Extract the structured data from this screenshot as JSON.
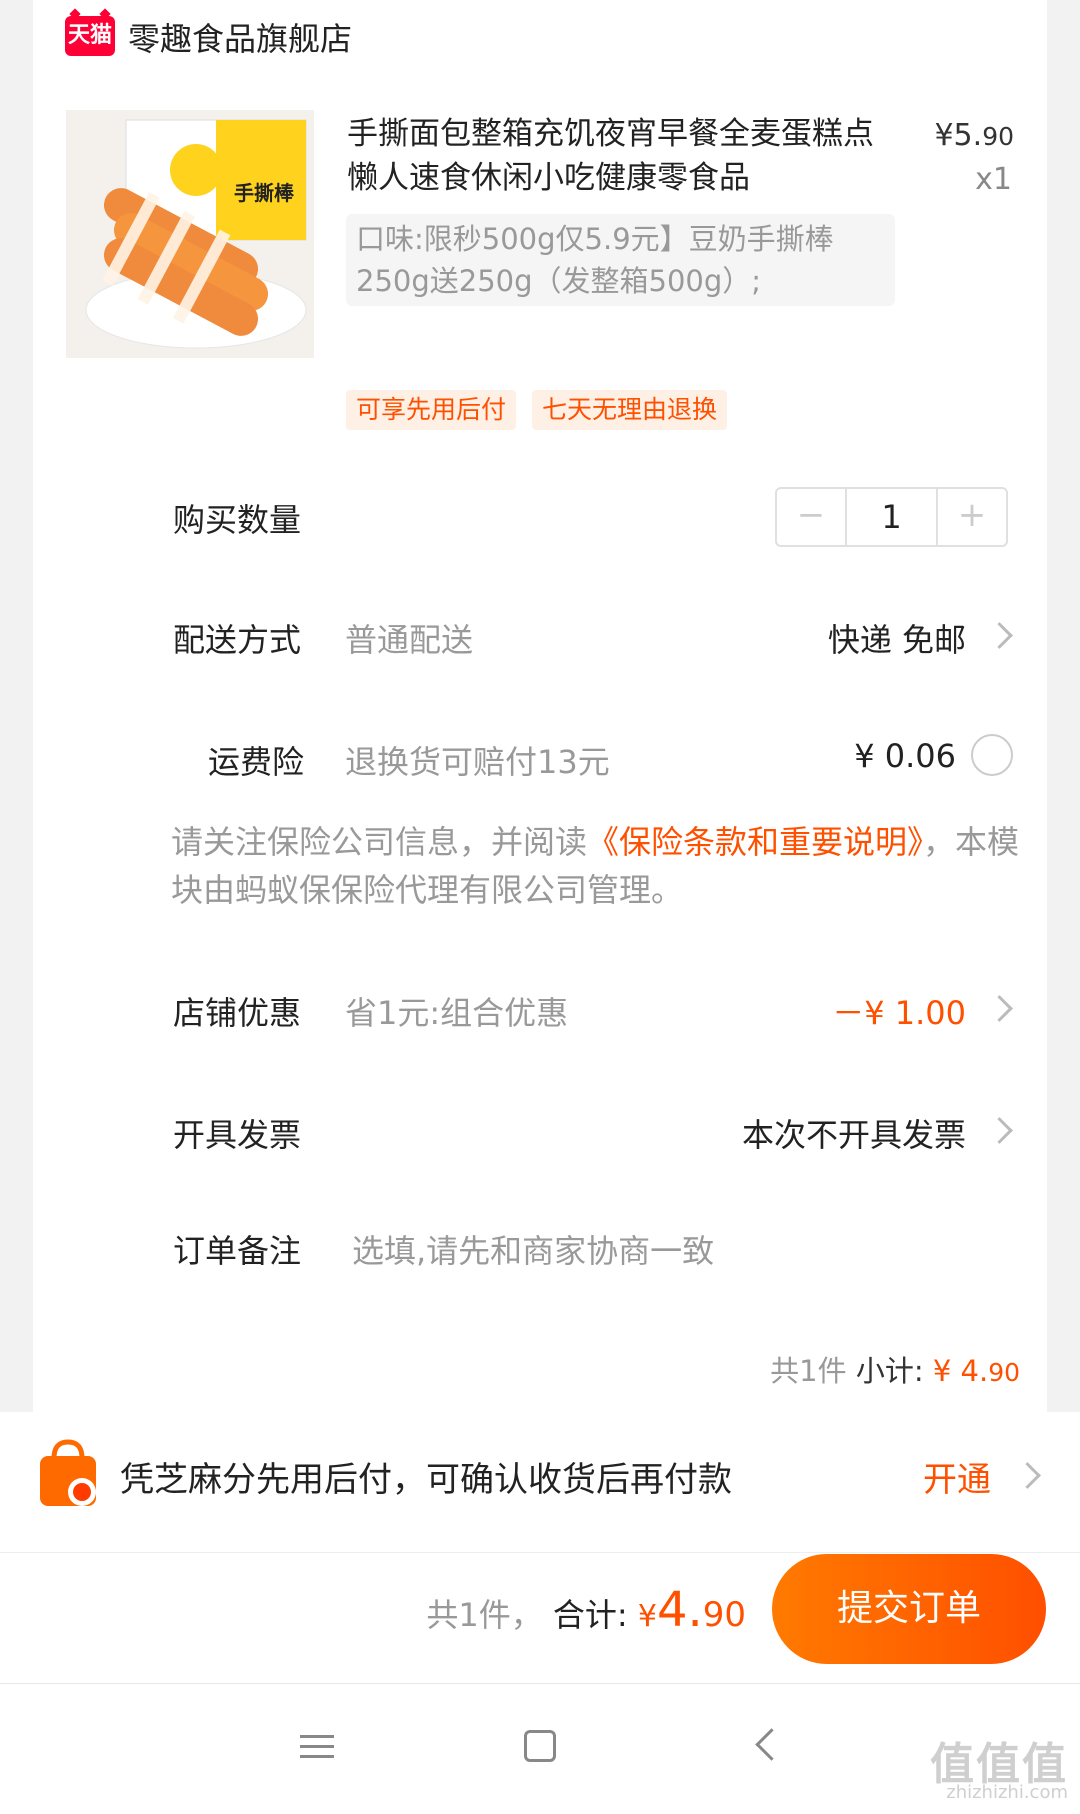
{
  "store": {
    "badge": "天猫",
    "name": "零趣食品旗舰店"
  },
  "product": {
    "title": "手撕面包整箱充饥夜宵早餐全麦蛋糕点懒人速食休闲小吃健康零食品",
    "price_main": "¥5.",
    "price_cents": "90",
    "quantity_label": "x1",
    "sku": "口味:限秒500g仅5.9元】豆奶手撕棒250g送250g（发整箱500g）;",
    "tags": [
      "可享先用后付",
      "七天无理由退换"
    ],
    "image_icon": "bread-rolls-image",
    "image_text": "手撕棒"
  },
  "rows": {
    "quantity": {
      "label": "购买数量",
      "minus": "−",
      "value": "1",
      "plus": "+"
    },
    "delivery": {
      "label": "配送方式",
      "sub": "普通配送",
      "value": "快递 免邮"
    },
    "insurance": {
      "label": "运费险",
      "sub": "退换货可赔付13元",
      "value": "¥ 0.06"
    },
    "insurance_notice": {
      "prefix": "请关注保险公司信息，并阅读",
      "link": "《保险条款和重要说明》",
      "suffix": "，本模块由蚂蚁保保险代理有限公司管理。"
    },
    "discount": {
      "label": "店铺优惠",
      "sub": "省1元:组合优惠",
      "value": "－¥ 1.00"
    },
    "invoice": {
      "label": "开具发票",
      "value": "本次不开具发票"
    },
    "remark": {
      "label": "订单备注",
      "placeholder": "选填,请先和商家协商一致"
    }
  },
  "subtotal": {
    "count": "共1件",
    "label": "小计:",
    "price_main": "¥ 4.",
    "price_cents": "90"
  },
  "paylater": {
    "text": "凭芝麻分先用后付，可确认收货后再付款",
    "action": "开通"
  },
  "footer": {
    "count": "共1件，",
    "label": "合计:",
    "currency": "¥",
    "price_main": "4.",
    "price_cents": "90",
    "submit": "提交订单"
  },
  "system_nav": {
    "menu_icon": "menu-icon",
    "home_icon": "home-icon",
    "back_icon": "back-icon"
  },
  "watermark": {
    "main": "值值值",
    "sub": "zhizhizhi.com"
  },
  "colors": {
    "accent": "#ff5000",
    "tmall": "#ff0036"
  }
}
